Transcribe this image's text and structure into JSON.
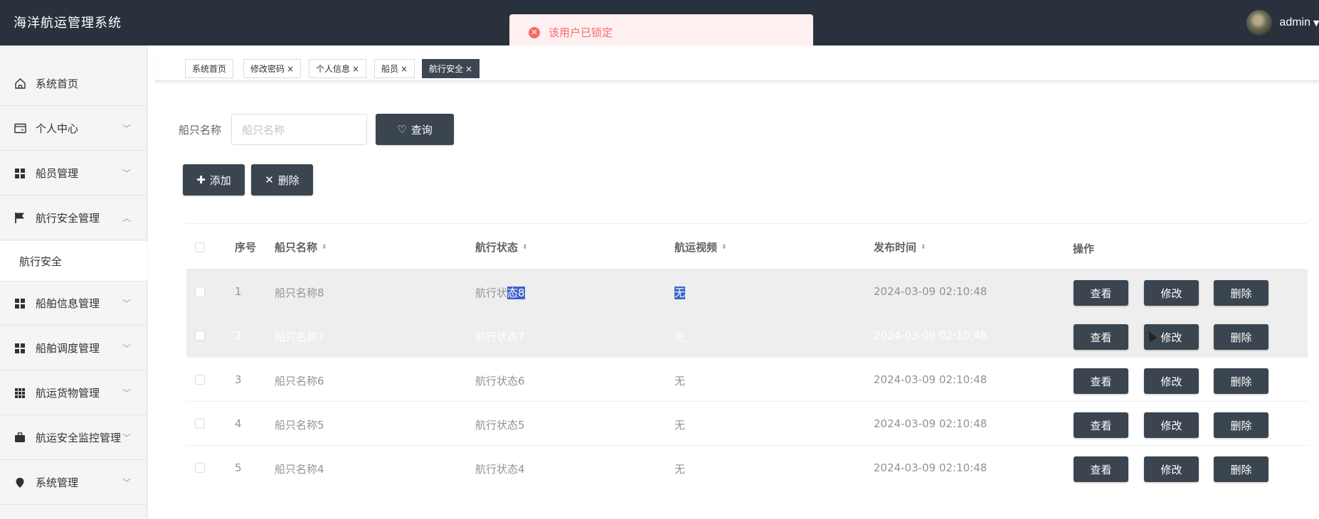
{
  "header": {
    "title": "海洋航运管理系统",
    "user": "admin",
    "caret": "▼"
  },
  "toast": {
    "icon": "error-icon",
    "message": "该用户已锁定",
    "color": "#f56c6c"
  },
  "sidebar": {
    "items": [
      {
        "label": "系统首页",
        "icon": "home-icon"
      },
      {
        "label": "个人中心",
        "icon": "wallet-icon",
        "arrow": "﹀"
      },
      {
        "label": "船员管理",
        "icon": "grid-icon",
        "arrow": "﹀"
      },
      {
        "label": "航行安全管理",
        "icon": "flag-icon",
        "arrow": "︿"
      },
      {
        "label": "航行安全",
        "icon": ""
      },
      {
        "label": "船舶信息管理",
        "icon": "grid-icon",
        "arrow": "﹀"
      },
      {
        "label": "船舶调度管理",
        "icon": "grid-icon",
        "arrow": "﹀"
      },
      {
        "label": "航运货物管理",
        "icon": "grid9-icon",
        "arrow": "﹀"
      },
      {
        "label": "航运安全监控管理",
        "icon": "briefcase-icon",
        "arrow": "﹀"
      },
      {
        "label": "系统管理",
        "icon": "location-icon",
        "arrow": "﹀"
      }
    ]
  },
  "tags": [
    {
      "label": "系统首页",
      "close": ""
    },
    {
      "label": "修改密码",
      "close": "×"
    },
    {
      "label": "个人信息",
      "close": "×"
    },
    {
      "label": "船员",
      "close": "×"
    },
    {
      "label": "航行安全",
      "close": "×"
    }
  ],
  "search": {
    "label": "船只名称",
    "placeholder": "船只名称",
    "button": "查询",
    "button_icon": "♡"
  },
  "actions": {
    "add": "添加",
    "add_icon": "✚",
    "delete": "删除",
    "delete_icon": "✕"
  },
  "table": {
    "headers": {
      "index": "序号",
      "name": "船只名称",
      "status": "航行状态",
      "video": "航运视频",
      "time": "发布时间",
      "ops": "操作"
    },
    "sort_icon": "⬍",
    "op_labels": {
      "view": "查看",
      "edit": "修改",
      "delete": "删除"
    },
    "rows": [
      {
        "index": "1",
        "name": "船只名称8",
        "status_pre": "航行状",
        "status_sel": "态8",
        "video": "无",
        "time": "2024-03-09 02:10:48"
      },
      {
        "index": "2",
        "name": "船只名称7",
        "status_pre": "航行状态7",
        "status_sel": "",
        "video": "无",
        "time": "2024-03-09 02:10:48"
      },
      {
        "index": "3",
        "name": "船只名称6",
        "status_pre": "航行状态6",
        "status_sel": "",
        "video": "无",
        "time": "2024-03-09 02:10:48"
      },
      {
        "index": "4",
        "name": "船只名称5",
        "status_pre": "航行状态5",
        "status_sel": "",
        "video": "无",
        "time": "2024-03-09 02:10:48"
      },
      {
        "index": "5",
        "name": "船只名称4",
        "status_pre": "航行状态4",
        "status_sel": "",
        "video": "无",
        "time": "2024-03-09 02:10:48"
      }
    ]
  },
  "colors": {
    "header_bg": "#29323c",
    "button_bg": "#3b4550",
    "selection": "#3a64c9"
  }
}
